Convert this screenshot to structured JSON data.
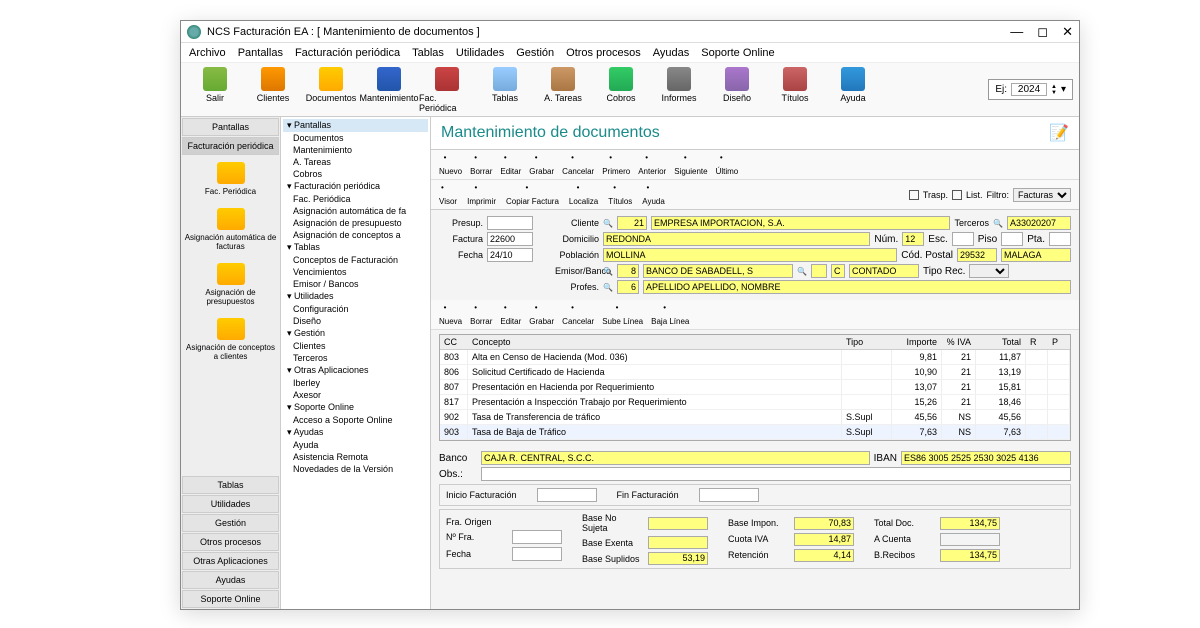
{
  "window": {
    "title": "NCS Facturación EA : [ Mantenimiento de documentos ]"
  },
  "menubar": [
    "Archivo",
    "Pantallas",
    "Facturación periódica",
    "Tablas",
    "Utilidades",
    "Gestión",
    "Otros procesos",
    "Ayudas",
    "Soporte Online"
  ],
  "toolbar": [
    {
      "label": "Salir",
      "icon": "ic-door"
    },
    {
      "label": "Clientes",
      "icon": "ic-user"
    },
    {
      "label": "Documentos",
      "icon": "ic-doc"
    },
    {
      "label": "Mantenimiento",
      "icon": "ic-maint"
    },
    {
      "label": "Fac. Periódica",
      "icon": "ic-cal"
    },
    {
      "label": "Tablas",
      "icon": "ic-tab"
    },
    {
      "label": "A. Tareas",
      "icon": "ic-task"
    },
    {
      "label": "Cobros",
      "icon": "ic-cob"
    },
    {
      "label": "Informes",
      "icon": "ic-rep"
    },
    {
      "label": "Diseño",
      "icon": "ic-des"
    },
    {
      "label": "Títulos",
      "icon": "ic-tit"
    },
    {
      "label": "Ayuda",
      "icon": "ic-help"
    }
  ],
  "ej": {
    "label": "Ej:",
    "value": "2024"
  },
  "accordion": {
    "top": [
      "Pantallas",
      "Facturación periódica"
    ],
    "items": [
      {
        "label": "Fac. Periódica"
      },
      {
        "label": "Asignación automática de facturas"
      },
      {
        "label": "Asignación de presupuestos"
      },
      {
        "label": "Asignación de conceptos a clientes"
      }
    ],
    "bottom": [
      "Tablas",
      "Utilidades",
      "Gestión",
      "Otros procesos",
      "Otras Aplicaciones",
      "Ayudas",
      "Soporte Online"
    ]
  },
  "tree": [
    {
      "t": "Pantallas",
      "l": 1,
      "sel": true
    },
    {
      "t": "Documentos",
      "l": 2
    },
    {
      "t": "Mantenimiento",
      "l": 2
    },
    {
      "t": "A. Tareas",
      "l": 2
    },
    {
      "t": "Cobros",
      "l": 2
    },
    {
      "t": "Facturación periódica",
      "l": 1
    },
    {
      "t": "Fac. Periódica",
      "l": 2
    },
    {
      "t": "Asignación automática de fa",
      "l": 2
    },
    {
      "t": "Asignación de presupuesto",
      "l": 2
    },
    {
      "t": "Asignación de conceptos a",
      "l": 2
    },
    {
      "t": "Tablas",
      "l": 1
    },
    {
      "t": "Conceptos de Facturación",
      "l": 2
    },
    {
      "t": "Vencimientos",
      "l": 2
    },
    {
      "t": "Emisor / Bancos",
      "l": 2
    },
    {
      "t": "Utilidades",
      "l": 1
    },
    {
      "t": "Configuración",
      "l": 2
    },
    {
      "t": "Diseño",
      "l": 2
    },
    {
      "t": "Gestión",
      "l": 1
    },
    {
      "t": "Clientes",
      "l": 2
    },
    {
      "t": "Terceros",
      "l": 2
    },
    {
      "t": "Otras Aplicaciones",
      "l": 1
    },
    {
      "t": "Iberley",
      "l": 2
    },
    {
      "t": "Axesor",
      "l": 2
    },
    {
      "t": "Soporte Online",
      "l": 1
    },
    {
      "t": "Acceso a Soporte Online",
      "l": 2
    },
    {
      "t": "Ayudas",
      "l": 1
    },
    {
      "t": "Ayuda",
      "l": 2
    },
    {
      "t": "Asistencia Remota",
      "l": 2
    },
    {
      "t": "Novedades de la Versión",
      "l": 2
    }
  ],
  "page": {
    "title": "Mantenimiento de documentos"
  },
  "row1": [
    "Nuevo",
    "Borrar",
    "Editar",
    "Grabar",
    "Cancelar",
    "Primero",
    "Anterior",
    "Siguiente",
    "Último"
  ],
  "row2": [
    "Visor",
    "Imprimir",
    "Copiar Factura",
    "Localiza",
    "Títulos",
    "Ayuda"
  ],
  "filter": {
    "trasp": "Trasp.",
    "list": "List.",
    "filtro": "Filtro:",
    "value": "Facturas"
  },
  "hdr": {
    "presup": "Presup.",
    "presup_v": "",
    "factura": "Factura",
    "factura_v": "22600",
    "fecha": "Fecha",
    "fecha_v": "24/10",
    "cliente": "Cliente",
    "cliente_n": "21",
    "cliente_v": "EMPRESA IMPORTACION, S.A.",
    "terceros": "Terceros",
    "terceros_v": "A33020207",
    "domicilio": "Domicilio",
    "domicilio_v": "REDONDA",
    "num": "Núm.",
    "num_v": "12",
    "esc": "Esc.",
    "piso": "Piso",
    "pta": "Pta.",
    "poblacion": "Población",
    "poblacion_v": "MOLLINA",
    "codpostal": "Cód. Postal",
    "codpostal_v": "29532",
    "prov_v": "MALAGA",
    "emisor": "Emisor/Banco",
    "emisor_n": "8",
    "emisor_v": "BANCO DE SABADELL, S",
    "c_v": "C",
    "contado": "CONTADO",
    "tiporec": "Tipo Rec.",
    "profes": "Profes.",
    "profes_n": "6",
    "profes_v": "APELLIDO APELLIDO, NOMBRE"
  },
  "linebtns": [
    "Nueva",
    "Borrar",
    "Editar",
    "Grabar",
    "Cancelar",
    "Sube Línea",
    "Baja Línea"
  ],
  "gridh": {
    "cc": "CC",
    "concepto": "Concepto",
    "tipo": "Tipo",
    "importe": "Importe",
    "iva": "% IVA",
    "total": "Total",
    "r": "R",
    "p": "P"
  },
  "rows": [
    {
      "cc": "803",
      "cn": "Alta en Censo de Hacienda (Mod. 036)",
      "tp": "",
      "im": "9,81",
      "iv": "21",
      "to": "11,87"
    },
    {
      "cc": "806",
      "cn": "Solicitud Certificado de Hacienda",
      "tp": "",
      "im": "10,90",
      "iv": "21",
      "to": "13,19"
    },
    {
      "cc": "807",
      "cn": "Presentación en Hacienda por Requerimiento",
      "tp": "",
      "im": "13,07",
      "iv": "21",
      "to": "15,81"
    },
    {
      "cc": "817",
      "cn": "Presentación a Inspección Trabajo por Requerimiento",
      "tp": "",
      "im": "15,26",
      "iv": "21",
      "to": "18,46"
    },
    {
      "cc": "902",
      "cn": "Tasa de Transferencia de tráfico",
      "tp": "S.Supl",
      "im": "45,56",
      "iv": "NS",
      "to": "45,56"
    },
    {
      "cc": "903",
      "cn": "Tasa de Baja de Tráfico",
      "tp": "S.Supl",
      "im": "7,63",
      "iv": "NS",
      "to": "7,63",
      "sel": true
    }
  ],
  "bank": {
    "banco": "Banco",
    "banco_v": "CAJA R. CENTRAL, S.C.C.",
    "iban": "IBAN",
    "iban_v": "ES86 3005 2525 2530 3025 4136",
    "obs": "Obs.:"
  },
  "fact": {
    "ini": "Inicio Facturación",
    "fin": "Fin Facturación"
  },
  "totals": {
    "fraorigen": "Fra. Origen",
    "nfra": "Nº Fra.",
    "fecha": "Fecha",
    "bns": "Base No Sujeta",
    "be": "Base Exenta",
    "bs": "Base Suplidos",
    "bs_v": "53,19",
    "bi": "Base Impon.",
    "bi_v": "70,83",
    "ci": "Cuota IVA",
    "ci_v": "14,87",
    "ret": "Retención",
    "ret_v": "4,14",
    "td": "Total Doc.",
    "td_v": "134,75",
    "ac": "A Cuenta",
    "br": "B.Recibos",
    "br_v": "134,75"
  }
}
